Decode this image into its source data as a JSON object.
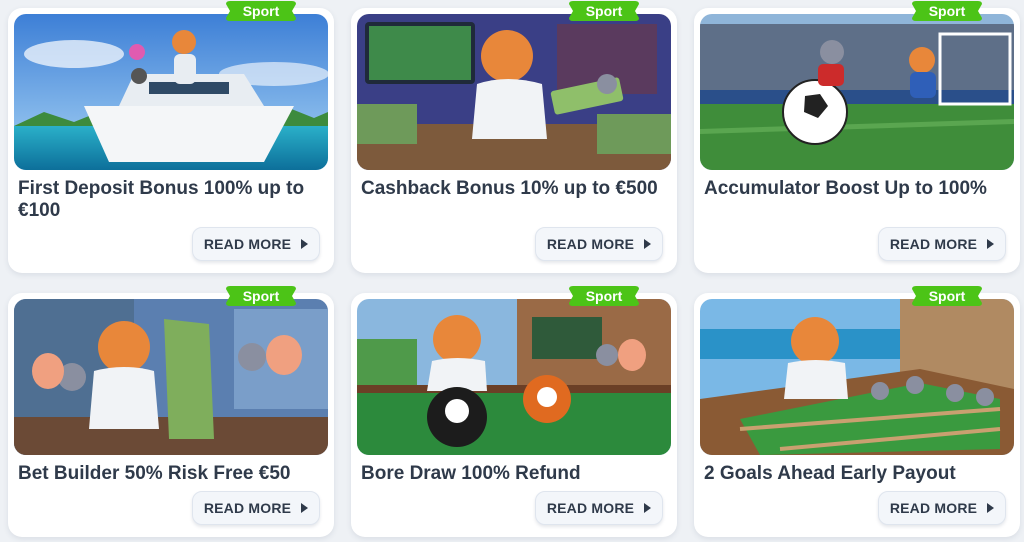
{
  "colors": {
    "badge_green": "#4cc417",
    "title_text": "#2f3a4a",
    "card_bg": "#ffffff",
    "page_bg": "#eef1f5"
  },
  "promotions": [
    {
      "badge": "Sport",
      "title": "First Deposit Bonus 100% up to €100",
      "button": "READ MORE",
      "image": "cat-on-yacht-illustration"
    },
    {
      "badge": "Sport",
      "title": "Cashback Bonus 10% up to €500",
      "button": "READ MORE",
      "image": "cat-counting-cash-illustration"
    },
    {
      "badge": "Sport",
      "title": "Accumulator Boost Up to 100%",
      "button": "READ MORE",
      "image": "stadium-football-illustration"
    },
    {
      "badge": "Sport",
      "title": "Bet Builder 50% Risk Free €50",
      "button": "READ MORE",
      "image": "cat-holding-money-illustration"
    },
    {
      "badge": "Sport",
      "title": "Bore Draw 100% Refund",
      "button": "READ MORE",
      "image": "billiards-illustration"
    },
    {
      "badge": "Sport",
      "title": "2 Goals Ahead Early Payout",
      "button": "READ MORE",
      "image": "table-football-illustration"
    }
  ]
}
